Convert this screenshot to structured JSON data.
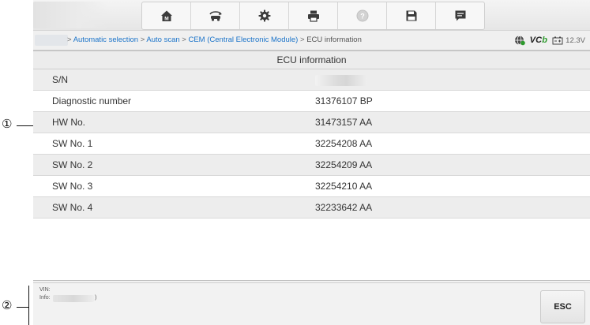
{
  "toolbar": {
    "buttons": [
      {
        "name": "home-button",
        "icon": "home-icon"
      },
      {
        "name": "vehicle-swap-button",
        "icon": "vehicle-swap-icon"
      },
      {
        "name": "settings-button",
        "icon": "gear-icon"
      },
      {
        "name": "print-button",
        "icon": "printer-icon"
      },
      {
        "name": "help-button",
        "icon": "help-icon"
      },
      {
        "name": "save-button",
        "icon": "save-icon"
      },
      {
        "name": "data-logging-button",
        "icon": "message-icon"
      }
    ]
  },
  "breadcrumb": {
    "items": [
      "Automatic selection",
      "Auto scan",
      "CEM (Central Electronic Module)"
    ],
    "separator": ">",
    "current": "ECU information"
  },
  "status": {
    "vci_prefix": "VC",
    "vci_suffix": "b",
    "battery_voltage": "12.3V"
  },
  "panel": {
    "title": "ECU information",
    "rows": [
      {
        "label": "S/N",
        "value": ""
      },
      {
        "label": "Diagnostic number",
        "value": "31376107 BP"
      },
      {
        "label": "HW No.",
        "value": "31473157 AA"
      },
      {
        "label": "SW No. 1",
        "value": "32254208 AA"
      },
      {
        "label": "SW No. 2",
        "value": "32254209 AA"
      },
      {
        "label": "SW No. 3",
        "value": "32254210 AA"
      },
      {
        "label": "SW No. 4",
        "value": "32233642 AA"
      }
    ]
  },
  "footer": {
    "vin_label": "VIN:",
    "info_label": "Info:",
    "info_tail": ")",
    "esc_label": "ESC"
  },
  "callouts": {
    "one": "①",
    "two": "②"
  },
  "colors": {
    "link": "#1a73c9",
    "vci_green": "#2e9a2e"
  }
}
